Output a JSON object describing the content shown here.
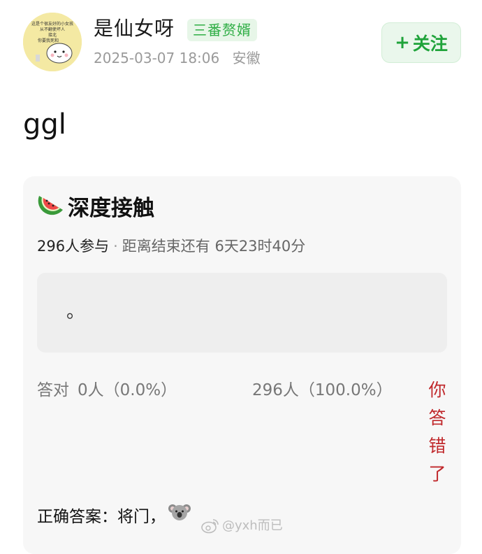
{
  "post": {
    "author": {
      "name": "是仙女呀",
      "badge": "三番赘婿",
      "avatar_caption": "这是个很友好的小女孩 从不翻使坏人 接北 你要我死和"
    },
    "date": "2025-03-07 18:06",
    "location": "安徽",
    "follow_plus": "+",
    "follow_label": "关注",
    "text": "ggl"
  },
  "quiz": {
    "title": "深度接触",
    "title_icon": "watermelon-icon",
    "participants": "296人参与",
    "separator": "·",
    "remaining": "距离结束还有 6天23时40分",
    "question": "。",
    "correct_label": "答对",
    "correct_value": "0人（0.0%）",
    "wrong_value": "296人（100.0%）",
    "wrong_tag": "你答错了",
    "answer_text": "正确答案：将门，",
    "answer_icon": "koala-icon"
  },
  "watermark": {
    "icon": "weibo-logo-icon",
    "text": "@yxh而已"
  },
  "colors": {
    "accent_green": "#1fa33a",
    "badge_green": "#2fae45",
    "wrong_red": "#c0282b",
    "card_bg": "#f7f7f7",
    "meta_gray": "#9a9a9a"
  }
}
